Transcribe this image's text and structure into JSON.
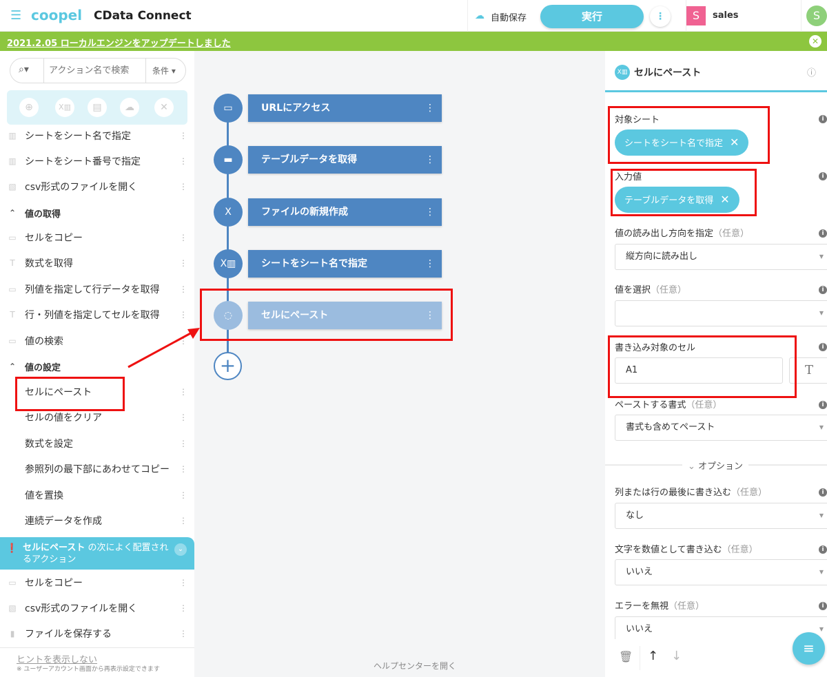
{
  "header": {
    "brand": "coopel",
    "app_title": "CData Connect",
    "autosave": "自動保存",
    "run": "実行",
    "user_initial": "S",
    "user_name": "sales",
    "account_initial": "S"
  },
  "banner": {
    "text": "2021.2.05 ローカルエンジンをアップデートしました"
  },
  "sidebar": {
    "search_placeholder": "アクション名で検索",
    "filter": "条件",
    "items": [
      {
        "label": "シートをシート名で指定",
        "icon": "excel-icon"
      },
      {
        "label": "シートをシート番号で指定",
        "icon": "excel-icon"
      },
      {
        "label": "csv形式のファイルを開く",
        "icon": "csv-icon"
      },
      {
        "label": "値の取得",
        "section": true
      },
      {
        "label": "セルをコピー",
        "icon": "cells-icon"
      },
      {
        "label": "数式を取得",
        "icon": "text-icon"
      },
      {
        "label": "列値を指定して行データを取得",
        "icon": "cells-icon"
      },
      {
        "label": "行・列値を指定してセルを取得",
        "icon": "text-icon"
      },
      {
        "label": "値の検索",
        "icon": "cells-icon"
      },
      {
        "label": "値の設定",
        "section": true
      },
      {
        "label": "セルにペースト"
      },
      {
        "label": "セルの値をクリア"
      },
      {
        "label": "数式を設定"
      },
      {
        "label": "参照列の最下部にあわせてコピー"
      },
      {
        "label": "値を置換"
      },
      {
        "label": "連続データを作成"
      }
    ],
    "hint_bold": "セルにペースト",
    "hint_rest": " の次によく配置されるアクション",
    "suggested": [
      {
        "label": "セルをコピー"
      },
      {
        "label": "csv形式のファイルを開く"
      },
      {
        "label": "ファイルを保存する"
      }
    ],
    "hide_hint": "ヒントを表示しない",
    "hide_hint_note": "※ ユーザーアカウント画面から再表示設定できます"
  },
  "flow": {
    "nodes": [
      {
        "label": "URLにアクセス"
      },
      {
        "label": "テーブルデータを取得"
      },
      {
        "label": "ファイルの新規作成"
      },
      {
        "label": "シートをシート名で指定"
      },
      {
        "label": "セルにペースト"
      }
    ],
    "help": "ヘルプセンターを開く"
  },
  "panel": {
    "title": "セルにペースト",
    "target_sheet_label": "対象シート",
    "target_sheet_chip": "シートをシート名で指定",
    "input_label": "入力値",
    "input_chip": "テーブルデータを取得",
    "direction_label": "値の読み出し方向を指定",
    "direction_value": "縦方向に読み出し",
    "select_value_label": "値を選択",
    "select_value_value": "",
    "cell_label": "書き込み対象のセル",
    "cell_value": "A1",
    "format_label": "ペーストする書式",
    "format_value": "書式も含めてペースト",
    "options": "オプション",
    "append_label": "列または行の最後に書き込む",
    "append_value": "なし",
    "numeric_label": "文字を数値として書き込む",
    "numeric_value": "いいえ",
    "ignore_label": "エラーを無視",
    "ignore_value": "いいえ",
    "optional": "（任意）"
  }
}
